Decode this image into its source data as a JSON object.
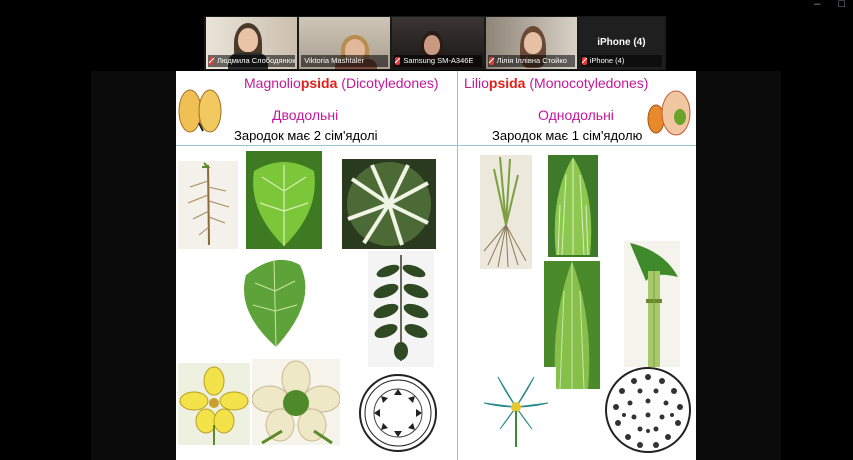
{
  "window_controls": {
    "minimize": "–",
    "restore": "□"
  },
  "participants": [
    {
      "name": "Людмила Слободянюк"
    },
    {
      "name": "Viktoria Mashtaler"
    },
    {
      "name": "Samsung SM-A346E"
    },
    {
      "name": "Лілія Іллівна Стойко"
    },
    {
      "name": "iPhone (4)",
      "title": "iPhone (4)"
    }
  ],
  "slide": {
    "left": {
      "title_prefix": "Magnolio",
      "title_highlight": "psida",
      "title_suffix": " (Dicotyledones)",
      "subtitle": "Дводольні",
      "description": "Зародок має 2 сім'ядолі"
    },
    "right": {
      "title_prefix": "Lilio",
      "title_highlight": "psida",
      "title_suffix": " (Monocotyledones)",
      "subtitle": "Однодольні",
      "description": "Зародок має 1 сім'ядолю"
    }
  }
}
